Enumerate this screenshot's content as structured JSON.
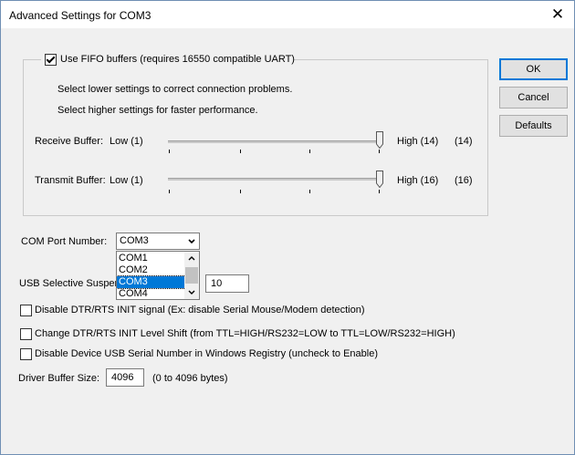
{
  "window": {
    "title": "Advanced Settings for COM3",
    "close_glyph": "✕"
  },
  "fifo": {
    "checkbox_label": "Use FIFO buffers (requires 16550 compatible UART)",
    "checked": true,
    "hint_lower": "Select lower settings to correct connection problems.",
    "hint_higher": "Select higher settings for faster performance.",
    "receive": {
      "label": "Receive Buffer:",
      "low": "Low (1)",
      "high": "High (14)",
      "value": "(14)",
      "level_fraction": 1.0
    },
    "transmit": {
      "label": "Transmit Buffer:",
      "low": "Low (1)",
      "high": "High (16)",
      "value": "(16)",
      "level_fraction": 1.0
    }
  },
  "buttons": {
    "ok": "OK",
    "cancel": "Cancel",
    "defaults": "Defaults"
  },
  "com_port": {
    "label": "COM Port Number:",
    "selected": "COM3",
    "options": [
      "COM1",
      "COM2",
      "COM3",
      "COM4"
    ]
  },
  "usb_suspend": {
    "label": "USB Selective Suspend",
    "value": "10"
  },
  "options": [
    {
      "label": "Disable DTR/RTS INIT signal (Ex: disable Serial Mouse/Modem detection)",
      "checked": false
    },
    {
      "label": "Change DTR/RTS INIT Level Shift (from TTL=HIGH/RS232=LOW to TTL=LOW/RS232=HIGH)",
      "checked": false
    },
    {
      "label": "Disable Device USB Serial Number in Windows Registry (uncheck to Enable)",
      "checked": false
    }
  ],
  "driver_buffer": {
    "label": "Driver Buffer Size:",
    "value": "4096",
    "range": "(0 to 4096 bytes)"
  },
  "colors": {
    "accent": "#0078d7",
    "window_bg": "#f0f0f0"
  }
}
